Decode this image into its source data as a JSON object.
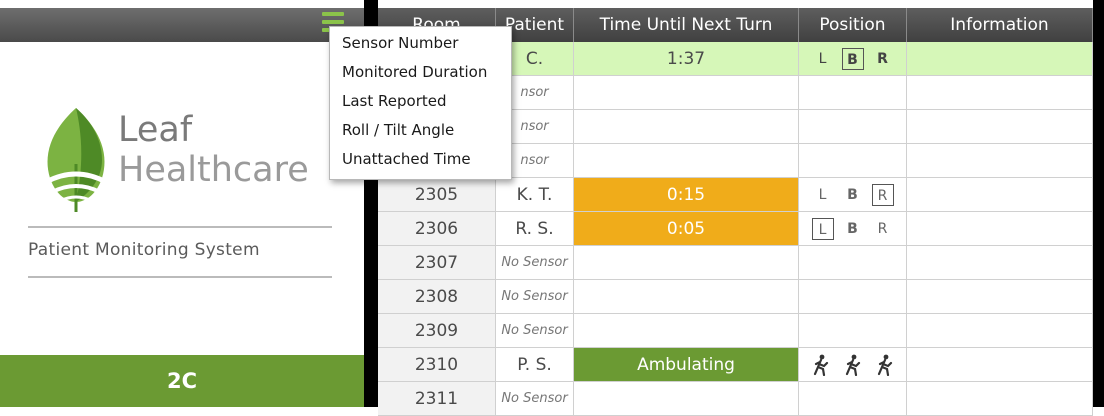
{
  "branding": {
    "logo_line1": "Leaf",
    "logo_line2": "Healthcare",
    "subtitle": "Patient Monitoring System",
    "unit": "2C"
  },
  "colors": {
    "brand_green": "#6b9a33",
    "row_highlight": "#d6f7b8",
    "warning_orange": "#f0ac1a",
    "header_gray": "#4a4a4a"
  },
  "menu": {
    "icon": "hamburger-menu-icon",
    "items": [
      "Sensor Number",
      "Monitored Duration",
      "Last Reported",
      "Roll / Tilt Angle",
      "Unattached Time"
    ]
  },
  "table": {
    "headers": {
      "room": "Room",
      "patient": "Patient",
      "time": "Time Until Next Turn",
      "position": "Position",
      "information": "Information"
    },
    "rows": [
      {
        "room": "",
        "patient": "C.",
        "time": "1:37",
        "position": [
          "L",
          "B",
          "R"
        ],
        "selected": "B",
        "status": "active"
      },
      {
        "room": "",
        "patient": "nsor",
        "time": "",
        "position": [],
        "status": "nosensor"
      },
      {
        "room": "",
        "patient": "nsor",
        "time": "",
        "position": [],
        "status": "nosensor"
      },
      {
        "room": "",
        "patient": "nsor",
        "time": "",
        "position": [],
        "status": "nosensor"
      },
      {
        "room": "2305",
        "patient": "K. T.",
        "time": "0:15",
        "position": [
          "L",
          "B",
          "R"
        ],
        "selected": "R",
        "status": "warning"
      },
      {
        "room": "2306",
        "patient": "R. S.",
        "time": "0:05",
        "position": [
          "L",
          "B",
          "R"
        ],
        "selected": "L",
        "status": "warning"
      },
      {
        "room": "2307",
        "patient": "No Sensor",
        "time": "",
        "position": [],
        "status": "nosensor"
      },
      {
        "room": "2308",
        "patient": "No Sensor",
        "time": "",
        "position": [],
        "status": "nosensor"
      },
      {
        "room": "2309",
        "patient": "No Sensor",
        "time": "",
        "position": [],
        "status": "nosensor"
      },
      {
        "room": "2310",
        "patient": "P. S.",
        "time": "Ambulating",
        "position": [
          "walk",
          "walk",
          "walk"
        ],
        "status": "ambulating"
      },
      {
        "room": "2311",
        "patient": "No Sensor",
        "time": "",
        "position": [],
        "status": "nosensor"
      }
    ]
  }
}
